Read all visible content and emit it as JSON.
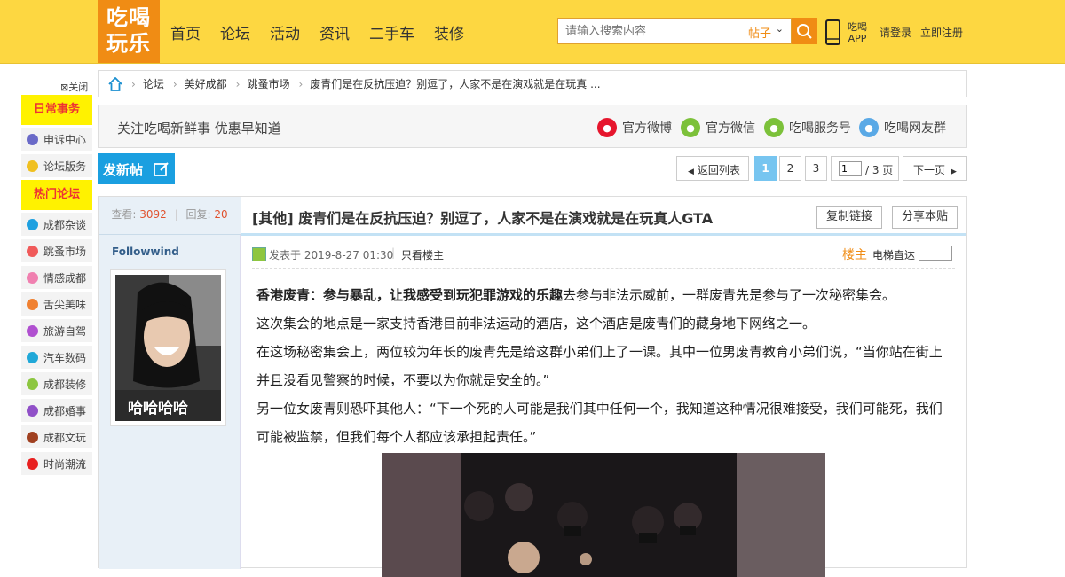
{
  "header": {
    "logo_line1": "吃喝",
    "logo_line2": "玩乐",
    "nav": [
      "首页",
      "论坛",
      "活动",
      "资讯",
      "二手车",
      "装修"
    ],
    "search_placeholder": "请输入搜索内容",
    "search_type": "帖子",
    "app_line1": "吃喝",
    "app_line2": "APP",
    "login": "请登录",
    "register": "立即注册"
  },
  "sidebar": {
    "close": "关闭",
    "section1": "日常事务",
    "section1_items": [
      "申诉中心",
      "论坛版务"
    ],
    "section2": "热门论坛",
    "section2_items": [
      "成都杂谈",
      "跳蚤市场",
      "情感成都",
      "舌尖美味",
      "旅游自驾",
      "汽车数码",
      "成都装修",
      "成都婚事",
      "成都文玩",
      "时尚潮流"
    ]
  },
  "breadcrumb": [
    "论坛",
    "美好成都",
    "跳蚤市场",
    "废青们是在反抗压迫？别逗了，人家不是在演戏就是在玩真 ..."
  ],
  "follow": {
    "text": "关注吃喝新鲜事 优惠早知道",
    "items": [
      "官方微博",
      "官方微信",
      "吃喝服务号",
      "吃喝网友群"
    ]
  },
  "toolbar": {
    "new_post": "发新帖",
    "back_list": "返回列表",
    "pages": [
      "1",
      "2",
      "3"
    ],
    "current_page": "1",
    "page_total": "/ 3 页",
    "next": "下一页"
  },
  "post": {
    "views_label": "查看:",
    "views": "3092",
    "replies_label": "回复:",
    "replies": "20",
    "author": "Followwind",
    "avatar_caption": "哈哈哈哈",
    "title": "[其他] 废青们是在反抗压迫？别逗了，人家不是在演戏就是在玩真人GTA",
    "copy_link": "复制链接",
    "share": "分享本贴",
    "posted_at": "发表于 2019-8-27 01:30",
    "only_op": "只看楼主",
    "op": "楼主",
    "elevator": "电梯直达",
    "lead_bold": "香港废青：参与暴乱，让我感受到玩犯罪游戏的乐趣",
    "lead_rest": "去参与非法示威前，一群废青先是参与了一次秘密集会。",
    "p1": "这次集会的地点是一家支持香港目前非法运动的酒店，这个酒店是废青们的藏身地下网络之一。",
    "p2": "在这场秘密集会上，两位较为年长的废青先是给这群小弟们上了一课。其中一位男废青教育小弟们说，“当你站在街上并且没看见警察的时候，不要以为你就是安全的。”",
    "p3": "另一位女废青则恐吓其他人：“下一个死的人可能是我们其中任何一个，我知道这种情况很难接受，我们可能死，我们可能被监禁，但我们每个人都应该承担起责任。”"
  }
}
